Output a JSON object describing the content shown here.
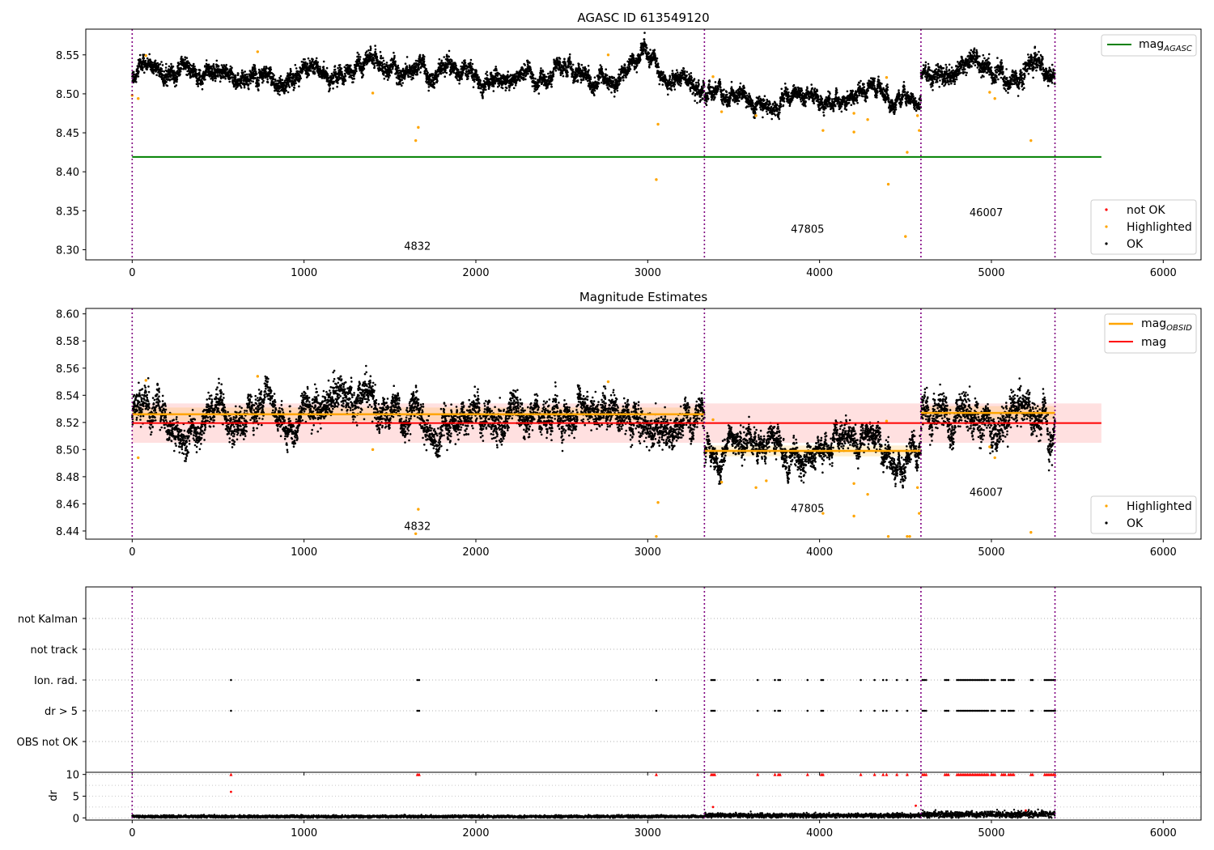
{
  "chart_data": [
    {
      "type": "scatter",
      "title": "AGASC ID 613549120",
      "xlim": [
        -270,
        6220
      ],
      "ylim": [
        8.287,
        8.583
      ],
      "yticks": [
        8.3,
        8.35,
        8.4,
        8.45,
        8.5,
        8.55
      ],
      "xticks": [
        0,
        1000,
        2000,
        3000,
        4000,
        5000,
        6000
      ],
      "obs_boundaries": [
        0,
        3330,
        4590,
        5370
      ],
      "obs_labels": [
        {
          "label": "4832",
          "x": 1660,
          "y": 8.3
        },
        {
          "label": "47805",
          "x": 3930,
          "y": 8.322
        },
        {
          "label": "46007",
          "x": 4970,
          "y": 8.343
        }
      ],
      "hlines": [
        {
          "name": "mag_AGASC",
          "y": 8.419,
          "x": [
            0,
            5640
          ],
          "color": "#008000"
        }
      ],
      "ok_segments": [
        {
          "x": [
            0,
            3330
          ],
          "mean": 8.526,
          "sd": 0.008
        },
        {
          "x": [
            3330,
            4590
          ],
          "mean": 8.497,
          "sd": 0.007
        },
        {
          "x": [
            4590,
            5370
          ],
          "mean": 8.527,
          "sd": 0.009
        }
      ],
      "highlighted_points": [
        [
          0,
          8.498
        ],
        [
          35,
          8.494
        ],
        [
          80,
          8.549
        ],
        [
          730,
          8.554
        ],
        [
          1400,
          8.501
        ],
        [
          1650,
          8.44
        ],
        [
          1665,
          8.457
        ],
        [
          2770,
          8.55
        ],
        [
          3050,
          8.39
        ],
        [
          3060,
          8.461
        ],
        [
          3380,
          8.522
        ],
        [
          3430,
          8.477
        ],
        [
          3630,
          8.472
        ],
        [
          4020,
          8.453
        ],
        [
          4200,
          8.451
        ],
        [
          4200,
          8.475
        ],
        [
          4280,
          8.467
        ],
        [
          4390,
          8.521
        ],
        [
          4400,
          8.384
        ],
        [
          4500,
          8.317
        ],
        [
          4510,
          8.425
        ],
        [
          4570,
          8.472
        ],
        [
          4580,
          8.453
        ],
        [
          4990,
          8.502
        ],
        [
          5020,
          8.494
        ],
        [
          5230,
          8.44
        ]
      ],
      "legend_series": [
        {
          "name": "mag_AGASC",
          "color": "#008000"
        }
      ],
      "legend_points": [
        {
          "name": "not OK",
          "color": "#ff0000"
        },
        {
          "name": "Highlighted",
          "color": "#ffa500"
        },
        {
          "name": "OK",
          "color": "#000000"
        }
      ]
    },
    {
      "type": "scatter",
      "title": "Magnitude Estimates",
      "xlim": [
        -270,
        6220
      ],
      "ylim": [
        8.434,
        8.604
      ],
      "yticks": [
        8.44,
        8.46,
        8.48,
        8.5,
        8.52,
        8.54,
        8.56,
        8.58,
        8.6
      ],
      "xticks": [
        0,
        1000,
        2000,
        3000,
        4000,
        5000,
        6000
      ],
      "obs_boundaries": [
        0,
        3330,
        4590,
        5370
      ],
      "obs_labels": [
        {
          "label": "4832",
          "x": 1660,
          "y": 8.441
        },
        {
          "label": "47805",
          "x": 3930,
          "y": 8.454
        },
        {
          "label": "46007",
          "x": 4970,
          "y": 8.466
        }
      ],
      "mag_line": {
        "name": "mag",
        "y": 8.5195,
        "band": [
          8.505,
          8.534
        ],
        "x": [
          0,
          5640
        ],
        "color": "#ff0000"
      },
      "mag_obsid": [
        {
          "x": [
            0,
            3330
          ],
          "y": 8.526,
          "band": [
            8.521,
            8.531
          ]
        },
        {
          "x": [
            3330,
            4590
          ],
          "y": 8.499,
          "band": [
            8.495,
            8.503
          ]
        },
        {
          "x": [
            4590,
            5370
          ],
          "y": 8.527,
          "band": [
            8.522,
            8.532
          ]
        }
      ],
      "ok_segments": [
        {
          "x": [
            0,
            3330
          ],
          "mean": 8.525,
          "sd": 0.009
        },
        {
          "x": [
            3330,
            4590
          ],
          "mean": 8.497,
          "sd": 0.007
        },
        {
          "x": [
            4590,
            5370
          ],
          "mean": 8.526,
          "sd": 0.01
        }
      ],
      "highlighted_points": [
        [
          35,
          8.494
        ],
        [
          80,
          8.551
        ],
        [
          730,
          8.554
        ],
        [
          1400,
          8.5
        ],
        [
          1650,
          8.438
        ],
        [
          1665,
          8.456
        ],
        [
          2770,
          8.55
        ],
        [
          3050,
          8.436
        ],
        [
          3060,
          8.461
        ],
        [
          3380,
          8.522
        ],
        [
          3430,
          8.476
        ],
        [
          3630,
          8.472
        ],
        [
          3690,
          8.477
        ],
        [
          4020,
          8.453
        ],
        [
          4200,
          8.451
        ],
        [
          4200,
          8.475
        ],
        [
          4280,
          8.467
        ],
        [
          4390,
          8.521
        ],
        [
          4400,
          8.436
        ],
        [
          4510,
          8.436
        ],
        [
          4525,
          8.436
        ],
        [
          4570,
          8.472
        ],
        [
          4580,
          8.453
        ],
        [
          4990,
          8.502
        ],
        [
          5020,
          8.494
        ],
        [
          5230,
          8.439
        ]
      ],
      "legend_series": [
        {
          "name": "mag_OBSID",
          "color": "#ffa500"
        },
        {
          "name": "mag",
          "color": "#ff0000"
        }
      ],
      "legend_points": [
        {
          "name": "Highlighted",
          "color": "#ffa500"
        },
        {
          "name": "OK",
          "color": "#000000"
        }
      ]
    },
    {
      "type": "scatter",
      "title": "",
      "xlim": [
        -270,
        6220
      ],
      "xticks": [
        0,
        1000,
        2000,
        3000,
        4000,
        5000,
        6000
      ],
      "obs_boundaries": [
        0,
        3330,
        4590,
        5370
      ],
      "flag_rows": [
        "not Kalman",
        "not track",
        "Ion. rad.",
        "dr > 5",
        "OBS not OK"
      ],
      "flag_events_x": [
        575,
        1660,
        1670,
        3050,
        3370,
        3380,
        3390,
        3640,
        3740,
        3760,
        3770,
        3930,
        4010,
        4020,
        4240,
        4320,
        4370,
        4390,
        4450,
        4510,
        4600,
        4610,
        4620,
        4730,
        4740,
        4750,
        4800,
        4810,
        4820,
        4830,
        4840,
        4850,
        4860,
        4870,
        4880,
        4890,
        4900,
        4910,
        4920,
        4930,
        4940,
        4950,
        4960,
        4970,
        4980,
        5000,
        5010,
        5020,
        5060,
        5070,
        5080,
        5100,
        5110,
        5120,
        5130,
        5230,
        5240,
        5310,
        5320,
        5330,
        5340,
        5350,
        5360,
        5370
      ],
      "dr": {
        "ylabel": "dr",
        "ylim": [
          -0.5,
          10.5
        ],
        "yticks": [
          0,
          5,
          10
        ],
        "baseline_segments": [
          {
            "x": [
              0,
              3330
            ],
            "mean": 0.3,
            "sd": 0.15
          },
          {
            "x": [
              3330,
              4590
            ],
            "mean": 0.55,
            "sd": 0.25
          },
          {
            "x": [
              4590,
              5370
            ],
            "mean": 0.8,
            "sd": 0.35
          }
        ],
        "outliers": [
          [
            575,
            6
          ],
          [
            3380,
            2.5
          ],
          [
            4560,
            2.8
          ],
          [
            5200,
            1.7
          ]
        ]
      }
    }
  ]
}
